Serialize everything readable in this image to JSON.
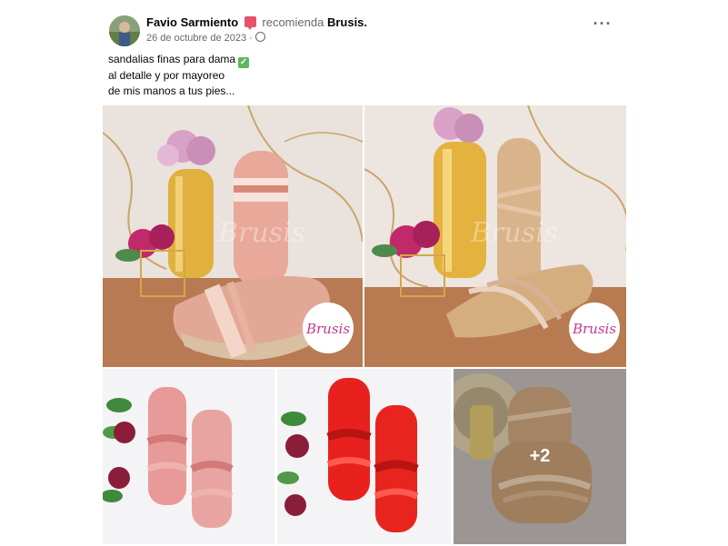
{
  "post": {
    "author": "Favio Sarmiento",
    "recommends_text": "recomienda",
    "page_name": "Brusis.",
    "date": "26 de octubre de 2023 ·",
    "more_label": "···",
    "caption": [
      "sandalias finas para dama",
      "al detalle y por mayoreo",
      "de mis manos a tus pies..."
    ]
  },
  "gallery": {
    "watermark": "Brusis",
    "photos": [
      {
        "alt": "Sandalias rosa con plataforma trenzada",
        "sandal_color": "#e7a595"
      },
      {
        "alt": "Sandalias doradas de tiras",
        "sandal_color": "#d9b48a"
      },
      {
        "alt": "Sandalias rosa palo de tiras trenzadas",
        "sandal_color": "#e89a98"
      },
      {
        "alt": "Sandalias rojas de tiras trenzadas",
        "sandal_color": "#e8211e"
      },
      {
        "alt": "Sandalias doradas metalizadas",
        "sandal_color": "#c9a27a"
      }
    ],
    "more_count": "+2"
  },
  "colors": {
    "muted_text": "#65676b",
    "recommend_icon": "#e8516a",
    "check_green": "#5cb85c"
  }
}
